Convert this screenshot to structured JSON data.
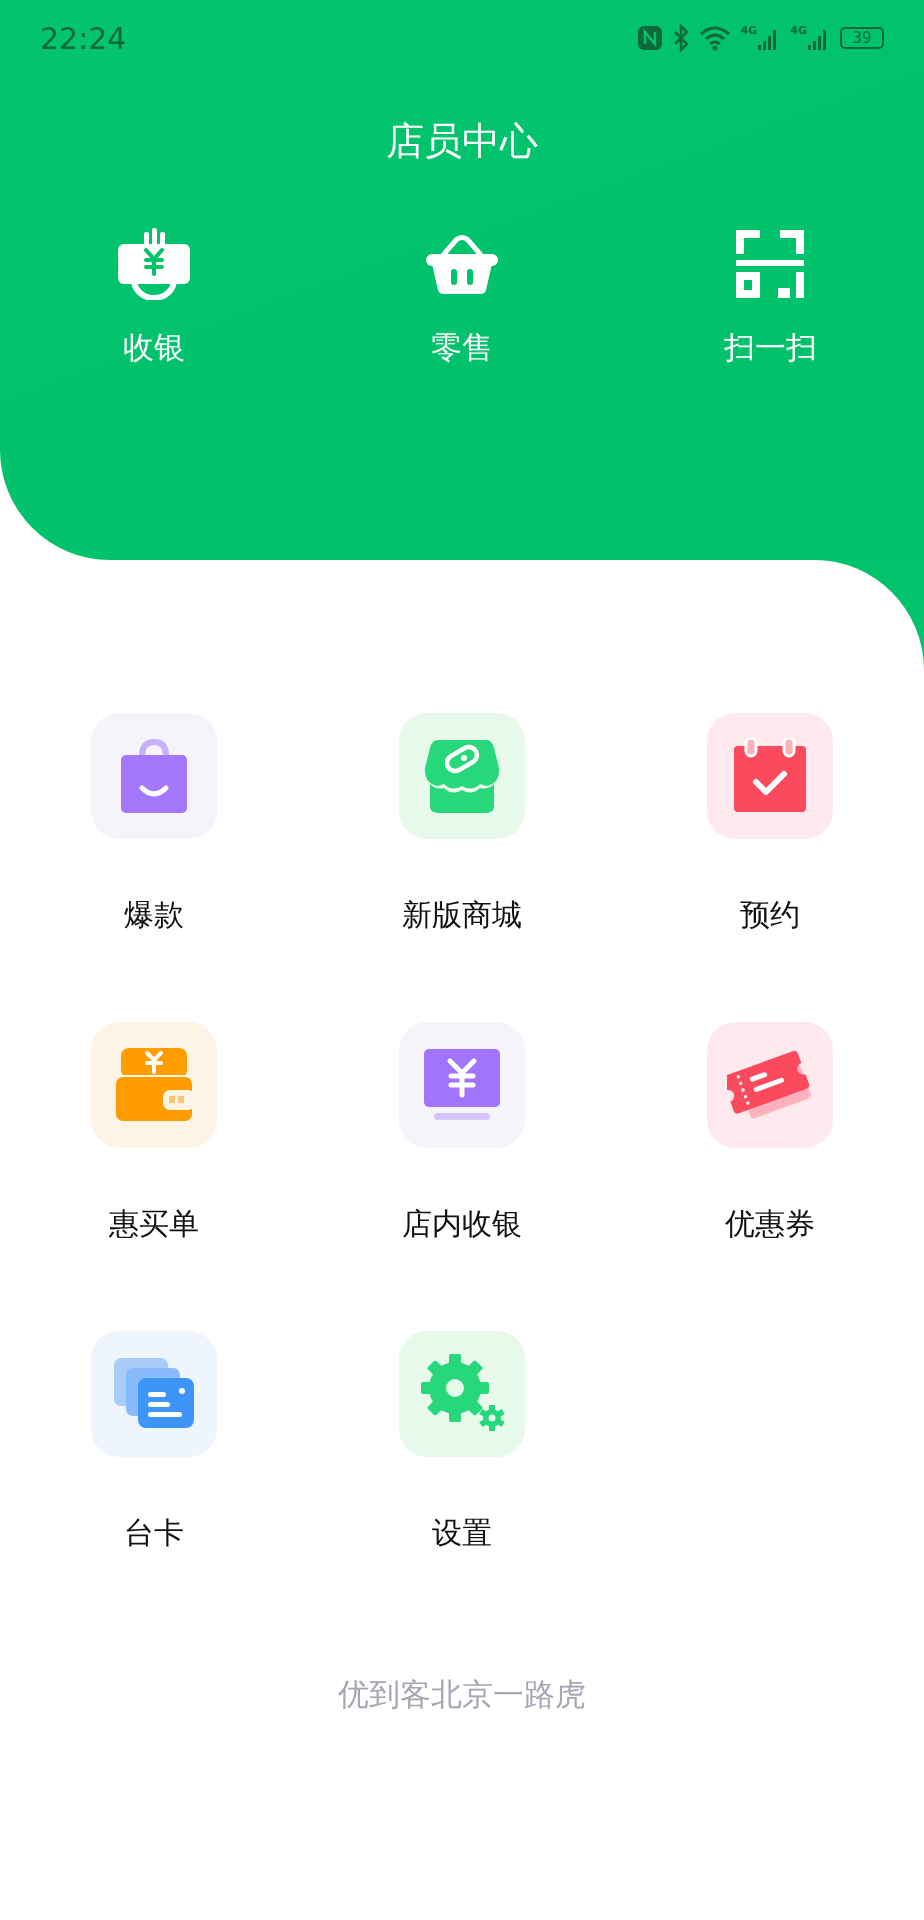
{
  "status_bar": {
    "time": "22:24",
    "networks": [
      "4G",
      "4G"
    ],
    "battery": "39"
  },
  "header": {
    "title": "店员中心"
  },
  "quick_actions": [
    {
      "label": "收银"
    },
    {
      "label": "零售"
    },
    {
      "label": "扫一扫"
    }
  ],
  "features": [
    {
      "label": "爆款"
    },
    {
      "label": "新版商城"
    },
    {
      "label": "预约"
    },
    {
      "label": "惠买单"
    },
    {
      "label": "店内收银"
    },
    {
      "label": "优惠券"
    },
    {
      "label": "台卡"
    },
    {
      "label": "设置"
    }
  ],
  "footer": {
    "store_name": "优到客北京一路虎"
  }
}
